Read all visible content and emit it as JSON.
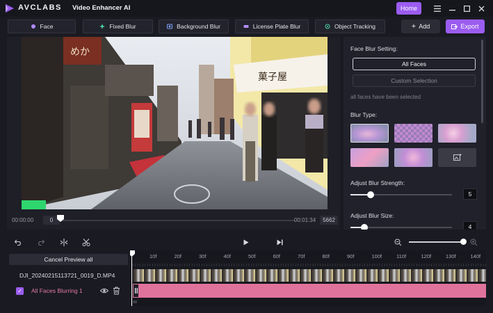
{
  "app": {
    "brand": "AVCLABS",
    "name": "Video Enhancer AI"
  },
  "header": {
    "home_label": "Home",
    "menu_icon": "hamburger-icon",
    "minimize_icon": "minimize-icon",
    "maximize_icon": "maximize-icon",
    "close_icon": "close-icon"
  },
  "tools": [
    {
      "label": "Face",
      "icon": "face-icon"
    },
    {
      "label": "Fixed Blur",
      "icon": "fixed-blur-icon"
    },
    {
      "label": "Background Blur",
      "icon": "background-blur-icon"
    },
    {
      "label": "License Plate Blur",
      "icon": "license-plate-icon"
    },
    {
      "label": "Object Tracking",
      "icon": "object-tracking-icon"
    }
  ],
  "actions": {
    "add_label": "Add",
    "export_label": "Export"
  },
  "preview": {
    "current_time": "00:00:00",
    "current_frame": "0",
    "end_time": "00:01:34",
    "total_frames": "5662"
  },
  "settings": {
    "face_blur_setting_label": "Face Blur Setting:",
    "all_faces_label": "All Faces",
    "custom_selection_label": "Custom Selection",
    "selection_note": "all faces have been selected",
    "blur_type_label": "Blur Type:",
    "blur_strength_label": "Adjust Blur Strength:",
    "blur_strength_value": "5",
    "blur_strength_fraction": 0.2,
    "blur_size_label": "Adjust Blur Size:",
    "blur_size_value": "4",
    "blur_size_fraction": 0.14
  },
  "timeline": {
    "cancel_preview_label": "Cancel Preview all",
    "file_name": "DJI_20240215113721_0019_D.MP4",
    "layer_name": "All Faces Blurring 1",
    "ticks": [
      "0",
      "10f",
      "20f",
      "30f",
      "40f",
      "50f",
      "60f",
      "70f",
      "80f",
      "90f",
      "100f",
      "110f",
      "120f",
      "130f",
      "140f"
    ],
    "zoom_fraction": 1.0
  },
  "colors": {
    "accent": "#9b5cf0",
    "layer": "#e0739c"
  }
}
